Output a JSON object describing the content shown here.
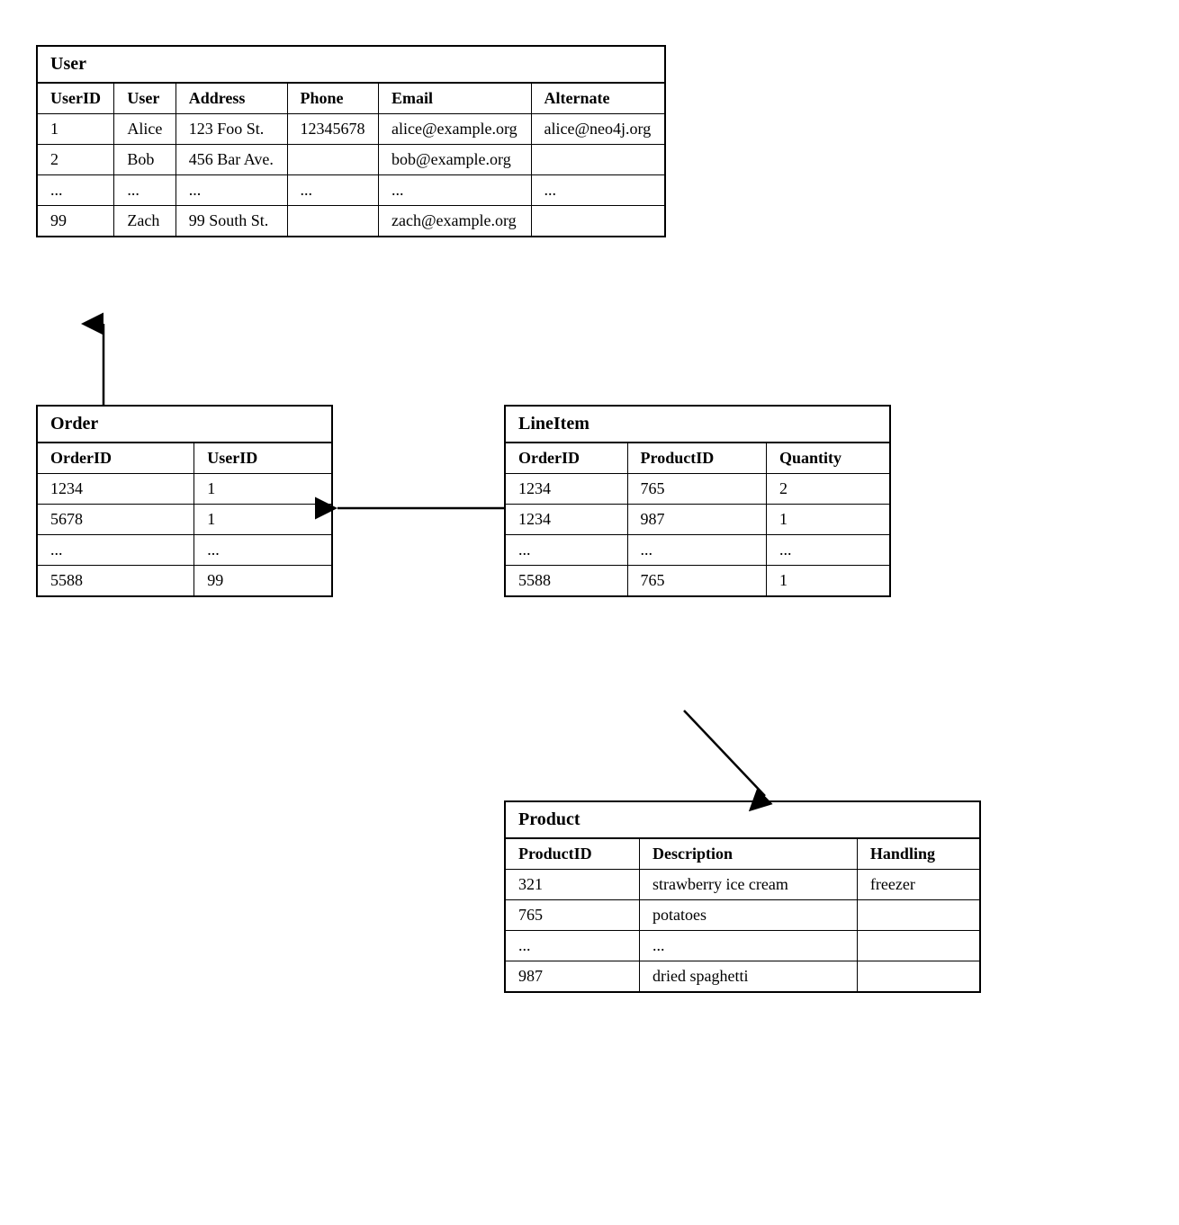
{
  "user_table": {
    "title": "User",
    "columns": [
      "UserID",
      "User",
      "Address",
      "Phone",
      "Email",
      "Alternate"
    ],
    "rows": [
      [
        "1",
        "Alice",
        "123 Foo St.",
        "12345678",
        "alice@example.org",
        "alice@neo4j.org"
      ],
      [
        "2",
        "Bob",
        "456 Bar Ave.",
        "",
        "bob@example.org",
        ""
      ],
      [
        "...",
        "...",
        "...",
        "...",
        "...",
        "..."
      ],
      [
        "99",
        "Zach",
        "99 South St.",
        "",
        "zach@example.org",
        ""
      ]
    ]
  },
  "order_table": {
    "title": "Order",
    "columns": [
      "OrderID",
      "UserID"
    ],
    "rows": [
      [
        "1234",
        "1"
      ],
      [
        "5678",
        "1"
      ],
      [
        "...",
        "..."
      ],
      [
        "5588",
        "99"
      ]
    ]
  },
  "lineitem_table": {
    "title": "LineItem",
    "columns": [
      "OrderID",
      "ProductID",
      "Quantity"
    ],
    "rows": [
      [
        "1234",
        "765",
        "2"
      ],
      [
        "1234",
        "987",
        "1"
      ],
      [
        "...",
        "...",
        "..."
      ],
      [
        "5588",
        "765",
        "1"
      ]
    ]
  },
  "product_table": {
    "title": "Product",
    "columns": [
      "ProductID",
      "Description",
      "Handling"
    ],
    "rows": [
      [
        "321",
        "strawberry ice cream",
        "freezer"
      ],
      [
        "765",
        "potatoes",
        ""
      ],
      [
        "...",
        "...",
        ""
      ],
      [
        "987",
        "dried spaghetti",
        ""
      ]
    ]
  }
}
